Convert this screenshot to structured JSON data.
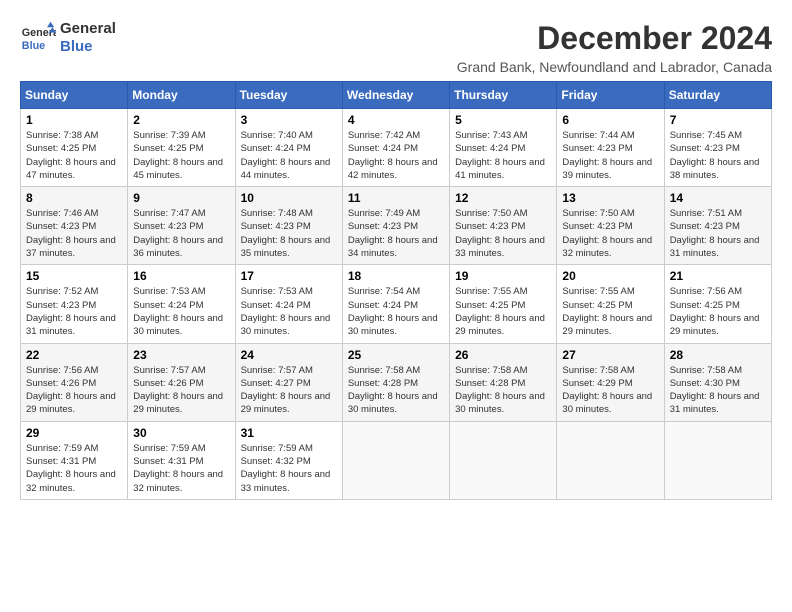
{
  "header": {
    "logo_line1": "General",
    "logo_line2": "Blue",
    "title": "December 2024",
    "subtitle": "Grand Bank, Newfoundland and Labrador, Canada"
  },
  "weekdays": [
    "Sunday",
    "Monday",
    "Tuesday",
    "Wednesday",
    "Thursday",
    "Friday",
    "Saturday"
  ],
  "weeks": [
    [
      {
        "day": "1",
        "sunrise": "7:38 AM",
        "sunset": "4:25 PM",
        "daylight": "8 hours and 47 minutes."
      },
      {
        "day": "2",
        "sunrise": "7:39 AM",
        "sunset": "4:25 PM",
        "daylight": "8 hours and 45 minutes."
      },
      {
        "day": "3",
        "sunrise": "7:40 AM",
        "sunset": "4:24 PM",
        "daylight": "8 hours and 44 minutes."
      },
      {
        "day": "4",
        "sunrise": "7:42 AM",
        "sunset": "4:24 PM",
        "daylight": "8 hours and 42 minutes."
      },
      {
        "day": "5",
        "sunrise": "7:43 AM",
        "sunset": "4:24 PM",
        "daylight": "8 hours and 41 minutes."
      },
      {
        "day": "6",
        "sunrise": "7:44 AM",
        "sunset": "4:23 PM",
        "daylight": "8 hours and 39 minutes."
      },
      {
        "day": "7",
        "sunrise": "7:45 AM",
        "sunset": "4:23 PM",
        "daylight": "8 hours and 38 minutes."
      }
    ],
    [
      {
        "day": "8",
        "sunrise": "7:46 AM",
        "sunset": "4:23 PM",
        "daylight": "8 hours and 37 minutes."
      },
      {
        "day": "9",
        "sunrise": "7:47 AM",
        "sunset": "4:23 PM",
        "daylight": "8 hours and 36 minutes."
      },
      {
        "day": "10",
        "sunrise": "7:48 AM",
        "sunset": "4:23 PM",
        "daylight": "8 hours and 35 minutes."
      },
      {
        "day": "11",
        "sunrise": "7:49 AM",
        "sunset": "4:23 PM",
        "daylight": "8 hours and 34 minutes."
      },
      {
        "day": "12",
        "sunrise": "7:50 AM",
        "sunset": "4:23 PM",
        "daylight": "8 hours and 33 minutes."
      },
      {
        "day": "13",
        "sunrise": "7:50 AM",
        "sunset": "4:23 PM",
        "daylight": "8 hours and 32 minutes."
      },
      {
        "day": "14",
        "sunrise": "7:51 AM",
        "sunset": "4:23 PM",
        "daylight": "8 hours and 31 minutes."
      }
    ],
    [
      {
        "day": "15",
        "sunrise": "7:52 AM",
        "sunset": "4:23 PM",
        "daylight": "8 hours and 31 minutes."
      },
      {
        "day": "16",
        "sunrise": "7:53 AM",
        "sunset": "4:24 PM",
        "daylight": "8 hours and 30 minutes."
      },
      {
        "day": "17",
        "sunrise": "7:53 AM",
        "sunset": "4:24 PM",
        "daylight": "8 hours and 30 minutes."
      },
      {
        "day": "18",
        "sunrise": "7:54 AM",
        "sunset": "4:24 PM",
        "daylight": "8 hours and 30 minutes."
      },
      {
        "day": "19",
        "sunrise": "7:55 AM",
        "sunset": "4:25 PM",
        "daylight": "8 hours and 29 minutes."
      },
      {
        "day": "20",
        "sunrise": "7:55 AM",
        "sunset": "4:25 PM",
        "daylight": "8 hours and 29 minutes."
      },
      {
        "day": "21",
        "sunrise": "7:56 AM",
        "sunset": "4:25 PM",
        "daylight": "8 hours and 29 minutes."
      }
    ],
    [
      {
        "day": "22",
        "sunrise": "7:56 AM",
        "sunset": "4:26 PM",
        "daylight": "8 hours and 29 minutes."
      },
      {
        "day": "23",
        "sunrise": "7:57 AM",
        "sunset": "4:26 PM",
        "daylight": "8 hours and 29 minutes."
      },
      {
        "day": "24",
        "sunrise": "7:57 AM",
        "sunset": "4:27 PM",
        "daylight": "8 hours and 29 minutes."
      },
      {
        "day": "25",
        "sunrise": "7:58 AM",
        "sunset": "4:28 PM",
        "daylight": "8 hours and 30 minutes."
      },
      {
        "day": "26",
        "sunrise": "7:58 AM",
        "sunset": "4:28 PM",
        "daylight": "8 hours and 30 minutes."
      },
      {
        "day": "27",
        "sunrise": "7:58 AM",
        "sunset": "4:29 PM",
        "daylight": "8 hours and 30 minutes."
      },
      {
        "day": "28",
        "sunrise": "7:58 AM",
        "sunset": "4:30 PM",
        "daylight": "8 hours and 31 minutes."
      }
    ],
    [
      {
        "day": "29",
        "sunrise": "7:59 AM",
        "sunset": "4:31 PM",
        "daylight": "8 hours and 32 minutes."
      },
      {
        "day": "30",
        "sunrise": "7:59 AM",
        "sunset": "4:31 PM",
        "daylight": "8 hours and 32 minutes."
      },
      {
        "day": "31",
        "sunrise": "7:59 AM",
        "sunset": "4:32 PM",
        "daylight": "8 hours and 33 minutes."
      },
      null,
      null,
      null,
      null
    ]
  ],
  "labels": {
    "sunrise": "Sunrise:",
    "sunset": "Sunset:",
    "daylight": "Daylight:"
  }
}
